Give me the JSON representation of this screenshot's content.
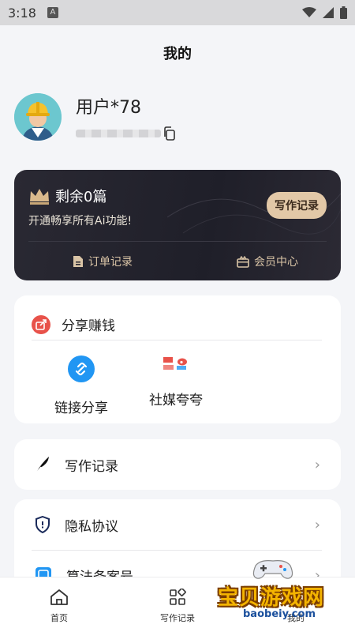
{
  "status_bar": {
    "time": "3:18",
    "notice_glyph": "A"
  },
  "page": {
    "title": "我的"
  },
  "profile": {
    "username": "用户*78"
  },
  "vip": {
    "remaining": "剩余0篇",
    "description": "开通畅享所有Ai功能!",
    "write_button": "写作记录",
    "order_link": "订单记录",
    "member_link": "会员中心"
  },
  "share": {
    "title": "分享赚钱",
    "items": [
      {
        "label": "链接分享",
        "icon": "link-icon"
      },
      {
        "label": "社媒夸夸",
        "icon": "social-media-icon"
      }
    ]
  },
  "menu": {
    "write_records": "写作记录",
    "privacy": "隐私协议",
    "algorithm": "算法备案号"
  },
  "tabs": [
    {
      "label": "首页",
      "icon": "home-icon"
    },
    {
      "label": "写作记录",
      "icon": "grid-icon"
    },
    {
      "label": "我的",
      "icon": "user-icon"
    }
  ],
  "watermark": {
    "text": "宝贝游戏网",
    "url": "baobeiy.com"
  },
  "colors": {
    "accent_gold": "#e2c8a7",
    "card_dark": "#24232d",
    "share_red": "#e8524a",
    "link_blue": "#2196f3"
  }
}
